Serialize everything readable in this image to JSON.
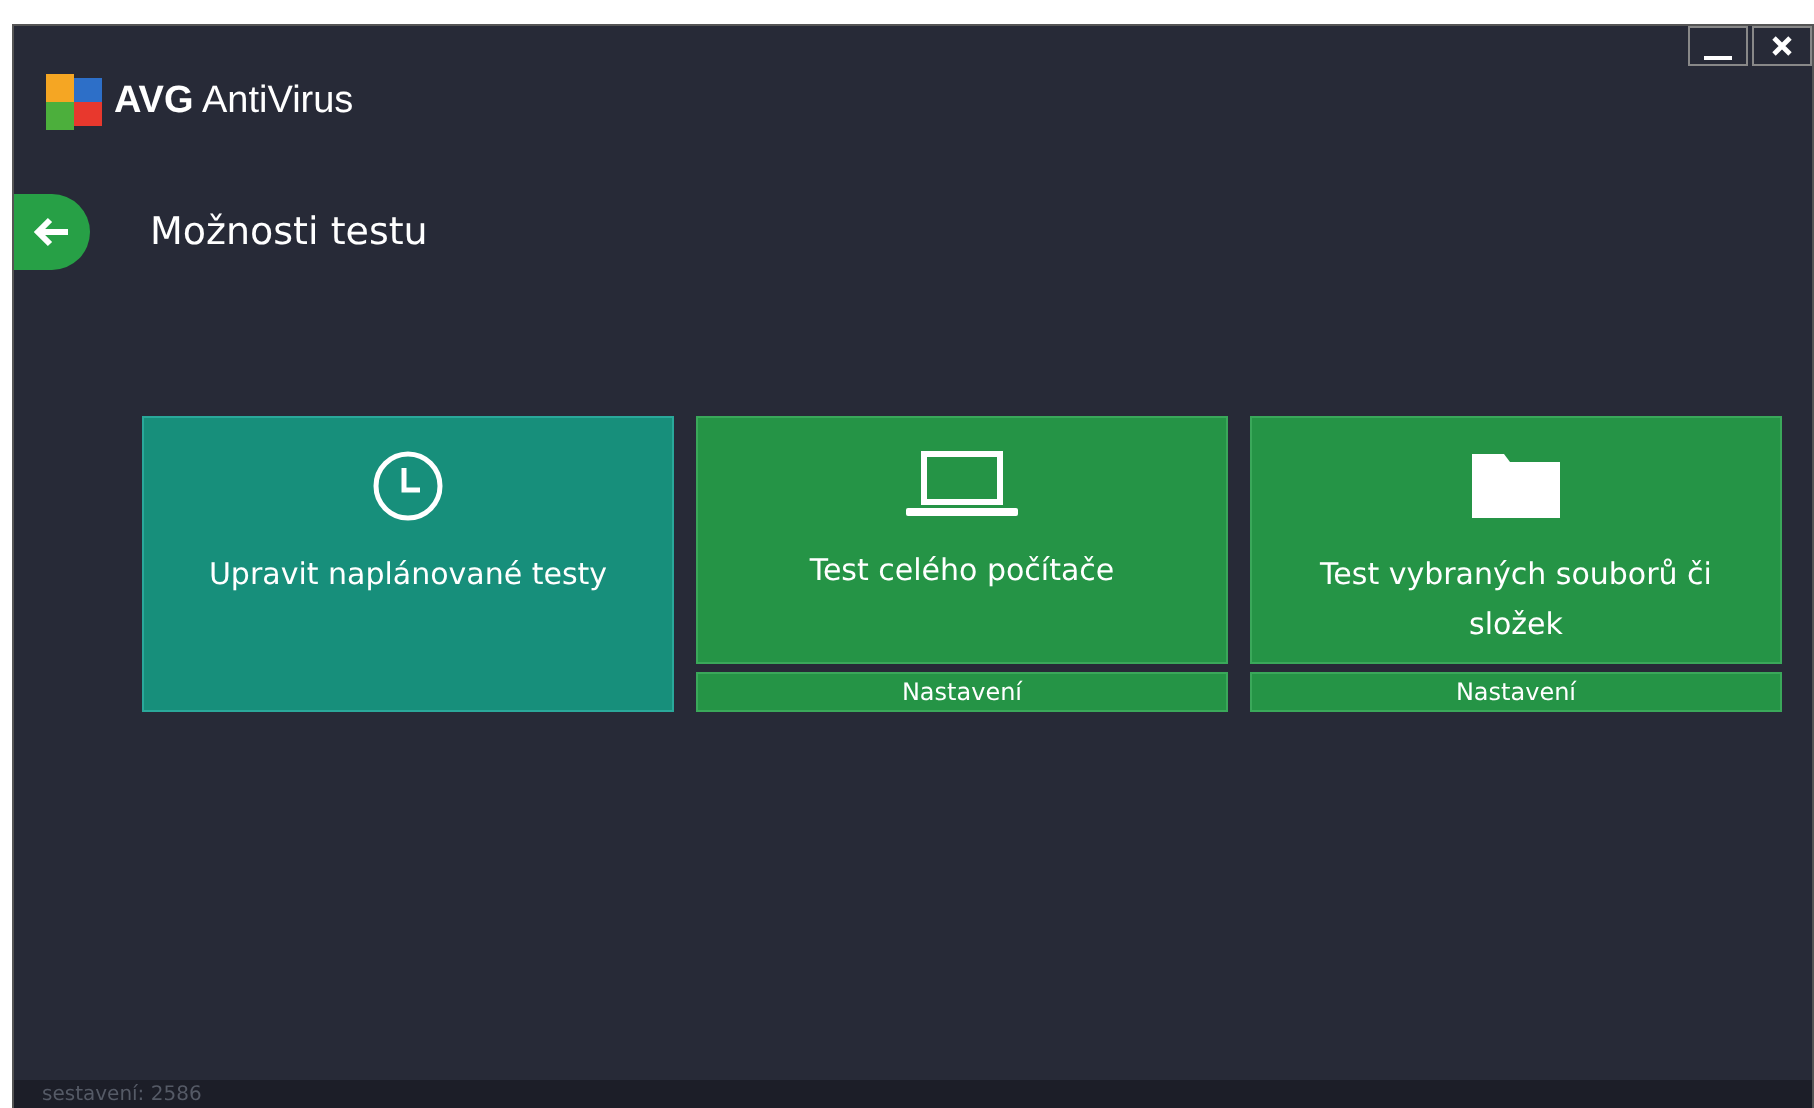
{
  "window": {
    "title": "AVG AntiVirus"
  },
  "header": {
    "title": "Možnosti testu"
  },
  "tiles": [
    {
      "kind": "schedule",
      "label": "Upravit naplánované testy"
    },
    {
      "kind": "computer",
      "label": "Test celého počítače",
      "settings": "Nastavení"
    },
    {
      "kind": "folder",
      "label": "Test vybraných souborů či složek",
      "settings": "Nastavení"
    }
  ],
  "status_bar": {
    "build": "sestavení: 2586"
  }
}
